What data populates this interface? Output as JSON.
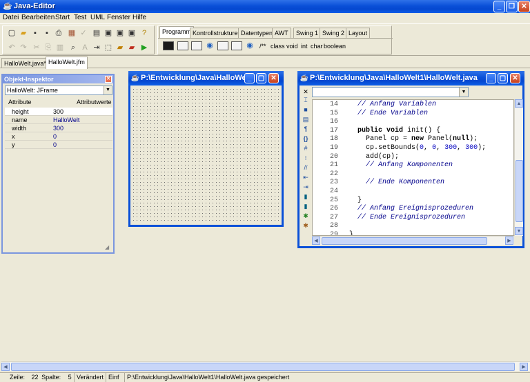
{
  "app": {
    "title": "Java-Editor",
    "caption_buttons": {
      "minimize": "_",
      "restore": "❐",
      "close": "✕"
    }
  },
  "menu": [
    "Datei",
    "Bearbeiten",
    "Start",
    "Test",
    "UML",
    "Fenster",
    "Hilfe"
  ],
  "palette": {
    "tabs": [
      "Programm",
      "Kontrollstrukturen",
      "Datentypen",
      "AWT",
      "Swing 1",
      "Swing 2",
      "Layout"
    ],
    "active_tab": "Programm",
    "keywords": [
      "/**",
      "class",
      "void",
      "int",
      "char",
      "boolean"
    ]
  },
  "doc_tabs": [
    "HalloWelt.java*",
    "HalloWelt.jfm"
  ],
  "inspector": {
    "title": "Objekt-Inspektor",
    "selected_object": "HalloWelt: JFrame",
    "col_attr": "Attribute",
    "col_values": "Attributwerte",
    "rows": [
      {
        "key": "height",
        "value": "300"
      },
      {
        "key": "name",
        "value": "HalloWelt"
      },
      {
        "key": "width",
        "value": "300"
      },
      {
        "key": "x",
        "value": "0"
      },
      {
        "key": "y",
        "value": "0"
      }
    ]
  },
  "designer": {
    "title": "P:\\Entwicklung\\Java\\HalloWe..."
  },
  "editor": {
    "title": "P:\\Entwicklung\\Java\\HalloWelt1\\HalloWelt.java",
    "lines": [
      {
        "n": "14",
        "text": "  // Anfang Variablen"
      },
      {
        "n": "15",
        "text": "  // Ende Variablen"
      },
      {
        "n": "16",
        "text": ""
      },
      {
        "n": "17",
        "text": "  public void init() {"
      },
      {
        "n": "18",
        "text": "    Panel cp = new Panel(null);"
      },
      {
        "n": "19",
        "text": "    cp.setBounds(0, 0, 300, 300);"
      },
      {
        "n": "20",
        "text": "    add(cp);"
      },
      {
        "n": "21",
        "text": "    // Anfang Komponenten"
      },
      {
        "n": "22",
        "text": ""
      },
      {
        "n": "23",
        "text": "    // Ende Komponenten"
      },
      {
        "n": "24",
        "text": ""
      },
      {
        "n": "25",
        "text": "  }"
      },
      {
        "n": "26",
        "text": "  // Anfang Ereignisprozeduren"
      },
      {
        "n": "27",
        "text": "  // Ende Ereignisprozeduren"
      },
      {
        "n": "28",
        "text": ""
      },
      {
        "n": "29",
        "text": "}"
      }
    ]
  },
  "status": {
    "zeile_label": "Zeile:",
    "zeile": "22",
    "spalte_label": "Spalte:",
    "spalte": "5",
    "modified": "Verändert",
    "mode": "Einf",
    "message": "P:\\Entwicklung\\Java\\HalloWelt1\\HalloWelt.java gespeichert"
  }
}
